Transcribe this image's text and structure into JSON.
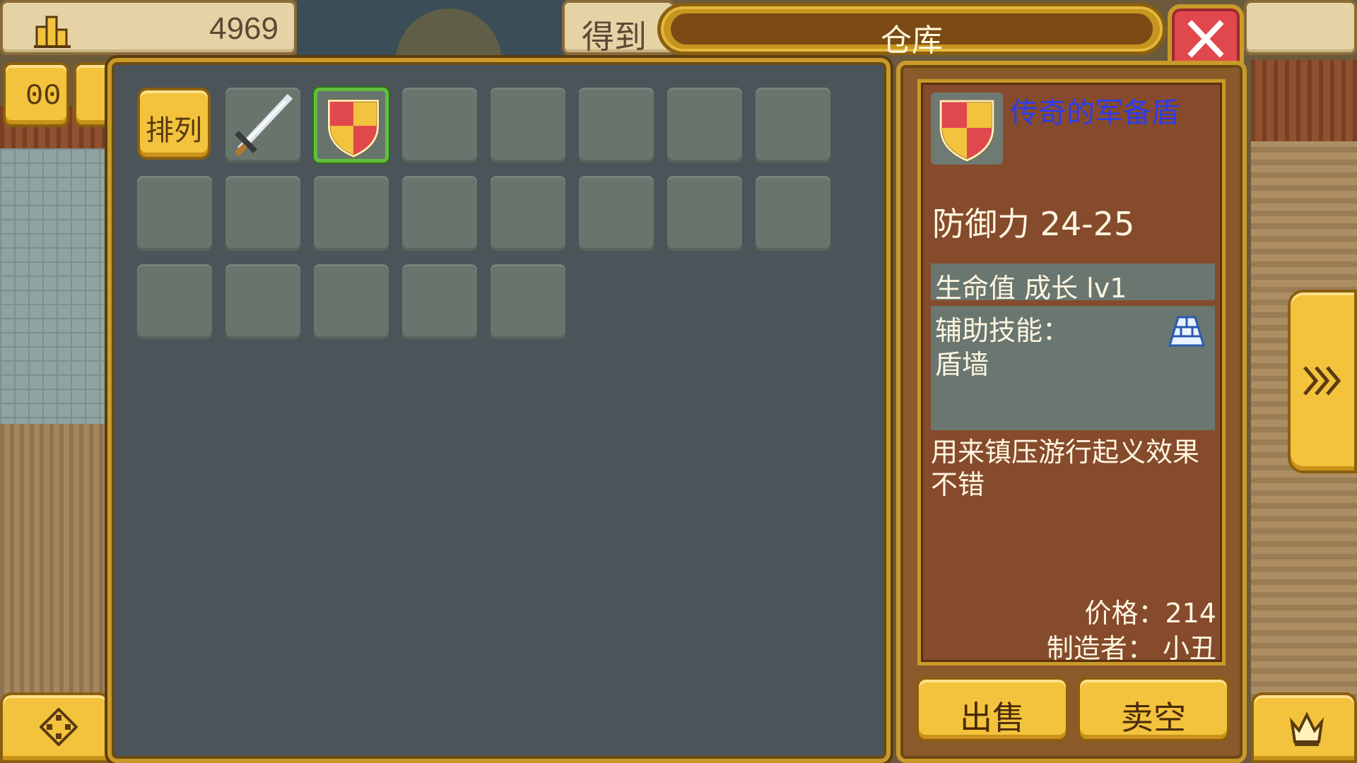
{
  "colors": {
    "panel": "#4b5458",
    "slot": "#69756c",
    "gold": "#f3c33d",
    "selected_border": "#5fbf3a",
    "item_name": "#2a3df0",
    "close": "#e0484e"
  },
  "top_bar": {
    "gold_icon": "gold-bars-icon",
    "gold_value": "4969",
    "obtain_label": "得到",
    "title": "仓库",
    "close_icon": "close-icon"
  },
  "side_buttons": {
    "pause": "00",
    "map_icon": "dpad-map-icon",
    "next_icon": "fast-forward-icon",
    "crown_icon": "crown-icon"
  },
  "storage": {
    "sort_label": "排列",
    "slots": [
      {
        "item": "sword",
        "selected": false
      },
      {
        "item": "shield",
        "selected": true
      },
      {
        "item": "",
        "selected": false
      },
      {
        "item": "",
        "selected": false
      },
      {
        "item": "",
        "selected": false
      },
      {
        "item": "",
        "selected": false
      },
      {
        "item": "",
        "selected": false
      },
      {
        "item": "",
        "selected": false
      },
      {
        "item": "",
        "selected": false
      },
      {
        "item": "",
        "selected": false
      },
      {
        "item": "",
        "selected": false
      },
      {
        "item": "",
        "selected": false
      },
      {
        "item": "",
        "selected": false
      },
      {
        "item": "",
        "selected": false
      },
      {
        "item": "",
        "selected": false
      },
      {
        "item": "",
        "selected": false
      },
      {
        "item": "",
        "selected": false
      },
      {
        "item": "",
        "selected": false
      },
      {
        "item": "",
        "selected": false
      },
      {
        "item": "",
        "selected": false
      }
    ]
  },
  "detail": {
    "item_icon": "shield-icon",
    "name": "传奇的军备盾",
    "stat": "防御力 24-25",
    "growth": "生命值 成长 lv1",
    "skill_label": "辅助技能：",
    "skill_name": "盾墙",
    "skill_icon": "shield-wall-icon",
    "description": "用来镇压游行起义效果不错",
    "price": "价格：214",
    "maker": "制造者： 小丑"
  },
  "actions": {
    "sell": "出售",
    "sell_all": "卖空"
  }
}
